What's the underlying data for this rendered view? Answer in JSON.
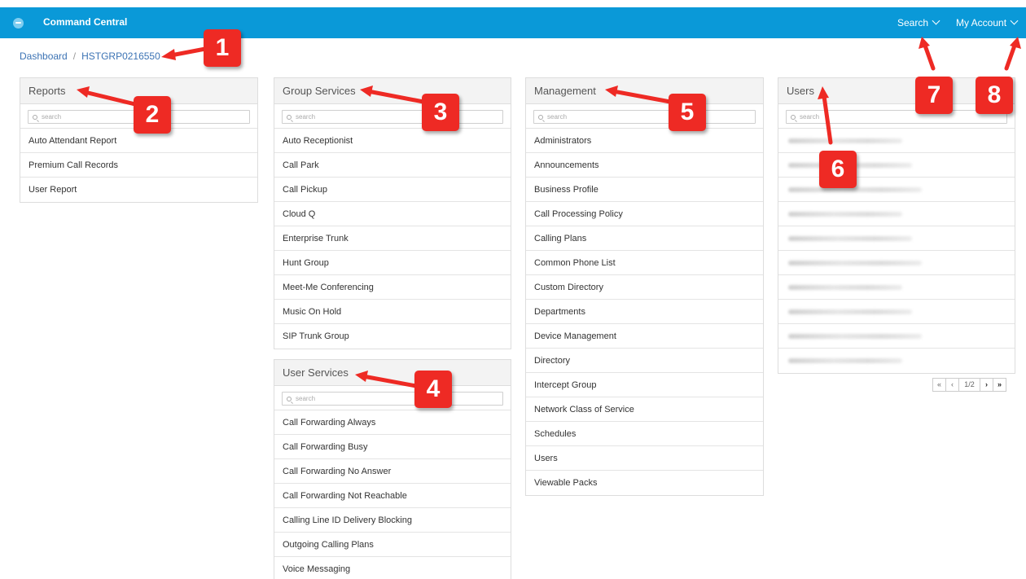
{
  "app": {
    "title": "Command Central"
  },
  "topnav": {
    "search_label": "Search",
    "account_label": "My Account"
  },
  "breadcrumb": {
    "home": "Dashboard",
    "separator": "/",
    "current": "HSTGRP0216550"
  },
  "search_placeholder": "search",
  "panels": {
    "reports": {
      "title": "Reports",
      "items": [
        "Auto Attendant Report",
        "Premium Call Records",
        "User Report"
      ]
    },
    "group_services": {
      "title": "Group Services",
      "items": [
        "Auto Receptionist",
        "Call Park",
        "Call Pickup",
        "Cloud Q",
        "Enterprise Trunk",
        "Hunt Group",
        "Meet-Me Conferencing",
        "Music On Hold",
        "SIP Trunk Group"
      ]
    },
    "user_services": {
      "title": "User Services",
      "items": [
        "Call Forwarding Always",
        "Call Forwarding Busy",
        "Call Forwarding No Answer",
        "Call Forwarding Not Reachable",
        "Calling Line ID Delivery Blocking",
        "Outgoing Calling Plans",
        "Voice Messaging"
      ]
    },
    "management": {
      "title": "Management",
      "items": [
        "Administrators",
        "Announcements",
        "Business Profile",
        "Call Processing Policy",
        "Calling Plans",
        "Common Phone List",
        "Custom Directory",
        "Departments",
        "Device Management",
        "Directory",
        "Intercept Group",
        "Network Class of Service",
        "Schedules",
        "Users",
        "Viewable Packs"
      ]
    },
    "users": {
      "title": "Users",
      "blurred_row_count": 10
    }
  },
  "pager": {
    "first": "«",
    "prev": "‹",
    "page": "1/2",
    "next": "›",
    "last": "»"
  },
  "callouts": [
    "1",
    "2",
    "3",
    "4",
    "5",
    "6",
    "7",
    "8"
  ],
  "colors": {
    "topbar": "#0a99d8",
    "link": "#3c73b4",
    "callout": "#ee2a24"
  }
}
